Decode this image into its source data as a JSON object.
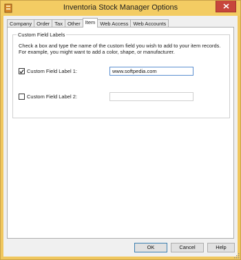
{
  "window": {
    "title": "Inventoria Stock Manager Options",
    "accent_color": "#f3cc63",
    "icons": {
      "app": "app-icon",
      "close": "close-icon"
    }
  },
  "tabs": [
    {
      "label": "Company",
      "active": false
    },
    {
      "label": "Order",
      "active": false
    },
    {
      "label": "Tax",
      "active": false
    },
    {
      "label": "Other",
      "active": false
    },
    {
      "label": "Item",
      "active": true
    },
    {
      "label": "Web Access",
      "active": false
    },
    {
      "label": "Web Accounts",
      "active": false
    }
  ],
  "item_tab": {
    "group_title": "Custom Field Labels",
    "instructions": "Check a box and type the name of the custom field you wish to add to your item records. For example, you might want to add a color, shape, or manufacturer.",
    "fields": [
      {
        "label": "Custom Field Label 1:",
        "checked": true,
        "value": "www.softpedia.com"
      },
      {
        "label": "Custom Field Label 2:",
        "checked": false,
        "value": ""
      }
    ]
  },
  "buttons": {
    "ok": "OK",
    "cancel": "Cancel",
    "help": "Help"
  }
}
